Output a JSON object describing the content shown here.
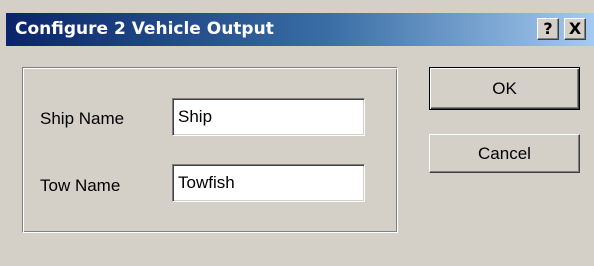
{
  "window": {
    "title": "Configure 2 Vehicle Output",
    "help_label": "?",
    "close_label": "X"
  },
  "form": {
    "ship_name_label": "Ship Name",
    "ship_name_value": "Ship",
    "tow_name_label": "Tow Name",
    "tow_name_value": "Towfish"
  },
  "buttons": {
    "ok_label": "OK",
    "cancel_label": "Cancel"
  },
  "colors": {
    "titlebar_start": "#0a246a",
    "titlebar_end": "#a6caf0",
    "dialog_background": "#d4d0c8"
  }
}
